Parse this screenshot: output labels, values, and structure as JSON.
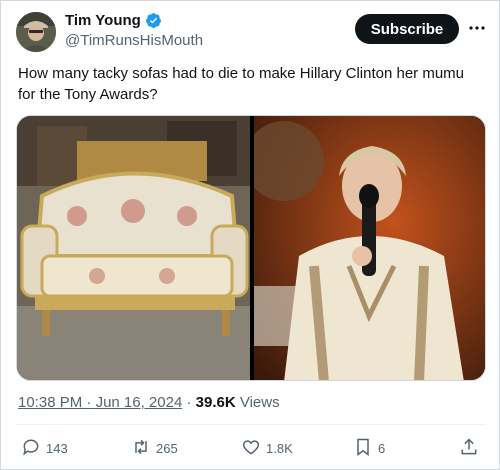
{
  "author": {
    "display_name": "Tim Young",
    "handle": "@TimRunsHisMouth",
    "verified_icon": "verified-badge-icon",
    "badge_color": "#1d9bf0"
  },
  "header": {
    "subscribe_label": "Subscribe",
    "more_icon": "more-dots-icon"
  },
  "tweet": {
    "text": "How many tacky sofas had to die to make Hillary Clinton her mumu for the Tony Awards?"
  },
  "media": {
    "images": [
      "ornate-sofa-photo",
      "woman-speaking-at-microphone-photo"
    ]
  },
  "meta": {
    "time": "10:38 PM",
    "separator": " · ",
    "date": "Jun 16, 2024",
    "separator2": " · ",
    "views_count": "39.6K",
    "views_label": " Views"
  },
  "actions": {
    "replies": "143",
    "reposts": "265",
    "likes": "1.8K",
    "bookmarks": "6"
  },
  "colors": {
    "text_primary": "#0f1419",
    "text_secondary": "#536471",
    "border": "#cfd9de"
  }
}
